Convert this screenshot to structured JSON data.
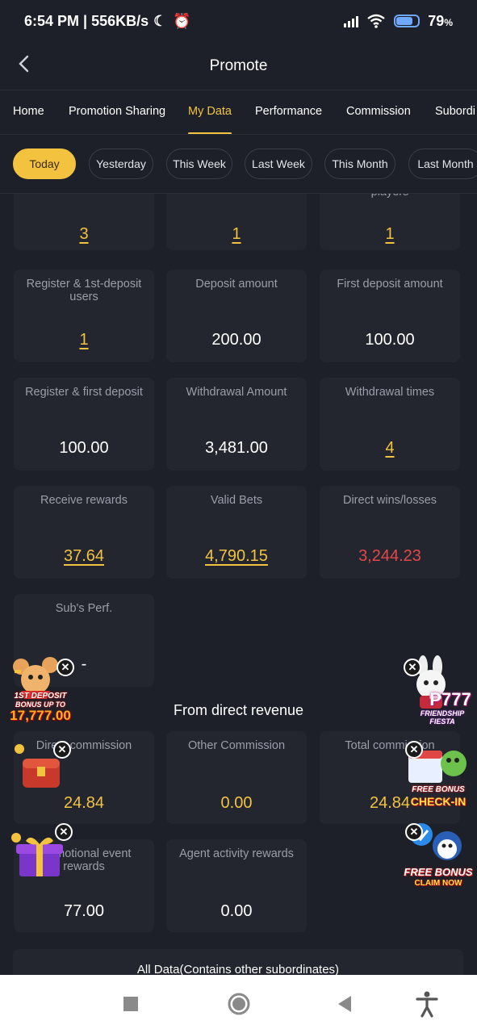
{
  "status_bar": {
    "time": "6:54 PM | 556KB/s",
    "battery": "79",
    "battery_unit": "%",
    "battery_level": 0.79
  },
  "header": {
    "title": "Promote"
  },
  "tabs": [
    {
      "label": "Home",
      "active": false
    },
    {
      "label": "Promotion Sharing",
      "active": false
    },
    {
      "label": "My Data",
      "active": true
    },
    {
      "label": "Performance",
      "active": false
    },
    {
      "label": "Commission",
      "active": false
    },
    {
      "label": "Subordi",
      "active": false
    }
  ],
  "filters": [
    {
      "label": "Today",
      "active": true
    },
    {
      "label": "Yesterday",
      "active": false
    },
    {
      "label": "This Week",
      "active": false
    },
    {
      "label": "Last Week",
      "active": false
    },
    {
      "label": "This Month",
      "active": false
    },
    {
      "label": "Last Month",
      "active": false
    }
  ],
  "stats_top_partial": {
    "third_label_fragment": "players",
    "values": [
      "3",
      "1",
      "1"
    ]
  },
  "stats": [
    {
      "label": "Register & 1st-deposit users",
      "value": "1"
    },
    {
      "label": "Deposit amount",
      "value": "200.00"
    },
    {
      "label": "First deposit amount",
      "value": "100.00"
    },
    {
      "label": "Register & first deposit",
      "value": "100.00"
    },
    {
      "label": "Withdrawal Amount",
      "value": "3,481.00"
    },
    {
      "label": "Withdrawal times",
      "value": "4"
    },
    {
      "label": "Receive rewards",
      "value": "37.64"
    },
    {
      "label": "Valid Bets",
      "value": "4,790.15"
    },
    {
      "label": "Direct wins/losses",
      "value": "3,244.23"
    },
    {
      "label": "Sub's Perf.",
      "value": "-"
    }
  ],
  "direct_revenue": {
    "title": "From direct revenue",
    "items": [
      {
        "label": "Direct commission",
        "value": "24.84"
      },
      {
        "label": "Other Commission",
        "value": "0.00"
      },
      {
        "label": "Total commission",
        "value": "24.84"
      },
      {
        "label": "Promotional event rewards",
        "value": "77.00"
      },
      {
        "label": "Agent activity rewards",
        "value": "0.00"
      }
    ]
  },
  "all_data": {
    "title": "All Data(Contains other subordinates)"
  },
  "floating_promos": {
    "deposit_bonus": {
      "line1": "1ST DEPOSIT",
      "line2": "BONUS UP TO",
      "amount": "17,777.00"
    },
    "friendship": {
      "amount": "₱777",
      "line1": "FRIENDSHIP",
      "line2": "FIESTA"
    },
    "checkin": {
      "line1": "FREE BONUS",
      "line2": "CHECK-IN"
    },
    "claim": {
      "line1": "FREE BONUS",
      "line2": "CLAIM NOW"
    }
  },
  "colors": {
    "accent": "#f3c340",
    "loss": "#e2484a",
    "background": "#1d2028",
    "card": "#23262e"
  }
}
